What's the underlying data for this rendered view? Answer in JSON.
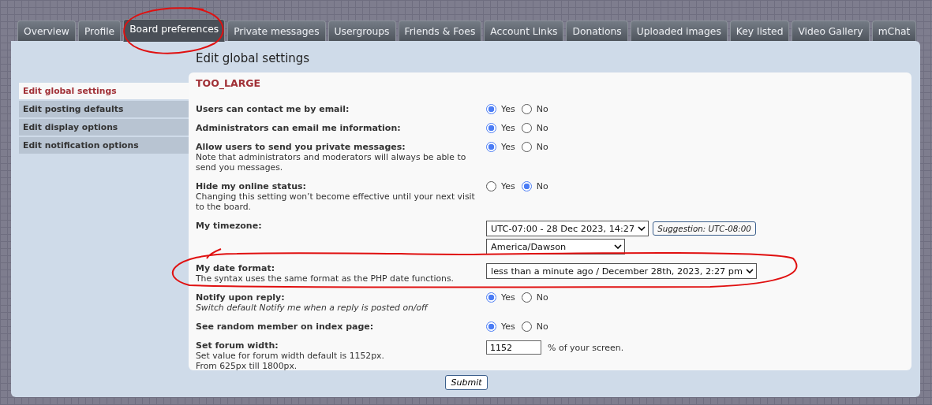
{
  "tabs": [
    {
      "label": "Overview",
      "selected": false
    },
    {
      "label": "Profile",
      "selected": false
    },
    {
      "label": "Board preferences",
      "selected": true
    },
    {
      "label": "Private messages",
      "selected": false
    },
    {
      "label": "Usergroups",
      "selected": false
    },
    {
      "label": "Friends & Foes",
      "selected": false
    },
    {
      "label": "Account Links",
      "selected": false
    },
    {
      "label": "Donations",
      "selected": false
    },
    {
      "label": "Uploaded images",
      "selected": false
    },
    {
      "label": "Key listed",
      "selected": false
    },
    {
      "label": "Video Gallery",
      "selected": false
    },
    {
      "label": "mChat",
      "selected": false
    }
  ],
  "heading": "Edit global settings",
  "menu": [
    {
      "label": "Edit global settings",
      "selected": true
    },
    {
      "label": "Edit posting defaults",
      "selected": false
    },
    {
      "label": "Edit display options",
      "selected": false
    },
    {
      "label": "Edit notification options",
      "selected": false
    }
  ],
  "section_title": "TOO_LARGE",
  "settings": [
    {
      "kind": "radio",
      "label": "Users can contact me by email:",
      "options": [
        {
          "label": "Yes",
          "selected": true
        },
        {
          "label": "No",
          "selected": false
        }
      ]
    },
    {
      "kind": "radio",
      "label": "Administrators can email me information:",
      "options": [
        {
          "label": "Yes",
          "selected": true
        },
        {
          "label": "No",
          "selected": false
        }
      ]
    },
    {
      "kind": "radio",
      "label": "Allow users to send you private messages:",
      "explain": "Note that administrators and moderators will always be able to send you messages.",
      "italic": false,
      "options": [
        {
          "label": "Yes",
          "selected": true
        },
        {
          "label": "No",
          "selected": false
        }
      ]
    },
    {
      "kind": "radio",
      "label": "Hide my online status:",
      "explain": "Changing this setting won’t become effective until your next visit to the board.",
      "italic": false,
      "options": [
        {
          "label": "Yes",
          "selected": false
        },
        {
          "label": "No",
          "selected": true
        }
      ]
    },
    {
      "kind": "timezone",
      "label": "My timezone:",
      "selects": [
        "UTC-07:00 - 28 Dec 2023, 14:27",
        "America/Dawson"
      ],
      "suggestion": "Suggestion: UTC-08:00"
    },
    {
      "kind": "select",
      "label": "My date format:",
      "explain": "The syntax uses the same format as the PHP date functions.",
      "italic": false,
      "value": "less than a minute ago / December 28th, 2023, 2:27 pm"
    },
    {
      "kind": "radio",
      "label": "Notify upon reply:",
      "explain": "Switch default Notify me when a reply is posted on/off",
      "italic": true,
      "options": [
        {
          "label": "Yes",
          "selected": true
        },
        {
          "label": "No",
          "selected": false
        }
      ]
    },
    {
      "kind": "radio",
      "label": "See random member on index page:",
      "options": [
        {
          "label": "Yes",
          "selected": true
        },
        {
          "label": "No",
          "selected": false
        }
      ]
    },
    {
      "kind": "number",
      "label": "Set forum width:",
      "explain": "Set value for forum width default is 1152px.\nFrom 625px till 1800px.",
      "italic": false,
      "value": "1152",
      "suffix": "% of your screen."
    }
  ],
  "submit": "Submit"
}
